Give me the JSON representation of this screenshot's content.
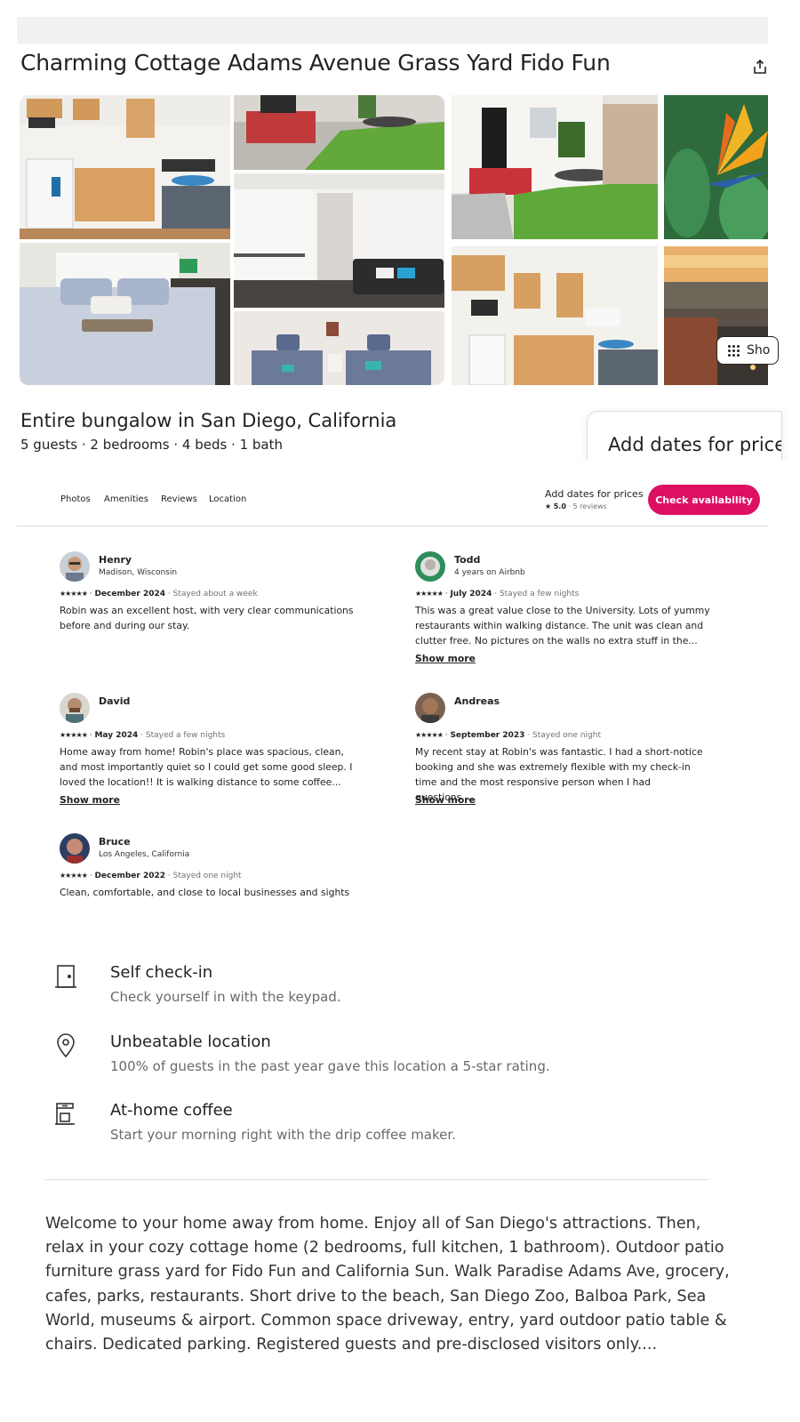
{
  "listing": {
    "title": "Charming Cottage Adams Avenue Grass Yard Fido Fun",
    "subtitle": "Entire bungalow in San Diego, California",
    "specs": "5 guests · 2 bedrooms · 4 beds · 1 bath",
    "price_card_text": "Add dates for price"
  },
  "gallery": {
    "show_all_label": "Sho",
    "photos": [
      "kitchen",
      "red-steps-patio",
      "living-room",
      "bedroom",
      "twin-beds",
      "front-patio",
      "bird-of-paradise-flower",
      "kitchen-wide",
      "city-sunset"
    ]
  },
  "nav": {
    "links": [
      "Photos",
      "Amenities",
      "Reviews",
      "Location"
    ],
    "price_text": "Add dates for prices",
    "rating_star": "★",
    "rating_value": "5.0",
    "rating_sep": "·",
    "rating_count": "5 reviews",
    "check_button": "Check availability"
  },
  "reviews": [
    {
      "name": "Henry",
      "sub": "Madison, Wisconsin",
      "stars": "★★★★★",
      "date": "December 2024",
      "stay": "· Stayed about a week",
      "text": "Robin was an excellent host, with very clear communications before and during our stay.",
      "more": ""
    },
    {
      "name": "Todd",
      "sub": "4 years on Airbnb",
      "stars": "★★★★★",
      "date": "July 2024",
      "stay": "· Stayed a few nights",
      "text": "This was a great value close to the University. Lots of yummy restaurants within walking distance. The unit was clean and clutter free. No pictures on the walls no extra stuff in the...",
      "more": "Show more"
    },
    {
      "name": "David",
      "sub": "",
      "stars": "★★★★★",
      "date": "May 2024",
      "stay": "· Stayed a few nights",
      "text": "Home away from home! Robin's place was spacious, clean, and most importantly quiet so I could get some good sleep. I loved the location!! It is walking distance to some coffee...",
      "more": "Show more"
    },
    {
      "name": "Andreas",
      "sub": "",
      "stars": "★★★★★",
      "date": "September 2023",
      "stay": "· Stayed one night",
      "text": "My recent stay at Robin's was fantastic. I had a short-notice booking and she was extremely flexible with my check-in time and the most responsive person when I had questions....",
      "more": "Show more"
    },
    {
      "name": "Bruce",
      "sub": "Los Angeles, California",
      "stars": "★★★★★",
      "date": "December 2022",
      "stay": "· Stayed one night",
      "text": "Clean, comfortable, and close to local businesses and sights",
      "more": ""
    }
  ],
  "highlights": [
    {
      "icon": "door-icon",
      "title": "Self check-in",
      "desc": "Check yourself in with the keypad."
    },
    {
      "icon": "location-pin-icon",
      "title": "Unbeatable location",
      "desc": "100% of guests in the past year gave this location a 5-star rating."
    },
    {
      "icon": "coffee-maker-icon",
      "title": "At-home coffee",
      "desc": "Start your morning right with the drip coffee maker."
    }
  ],
  "description": "Welcome to your home away from home. Enjoy all of San Diego's attractions. Then, relax in your cozy cottage home (2 bedrooms, full kitchen, 1 bathroom). Outdoor patio furniture grass yard for Fido Fun and California Sun. Walk Paradise Adams Ave, grocery, cafes, parks, restaurants. Short drive to the beach, San Diego Zoo, Balboa Park, Sea World, museums & airport. Common space driveway, entry, yard outdoor patio table & chairs. Dedicated parking. Registered guests and pre-disclosed visitors only....",
  "colors": {
    "accent": "#dd1062",
    "text": "#222222",
    "muted": "#717171",
    "divider": "#dddddd"
  }
}
